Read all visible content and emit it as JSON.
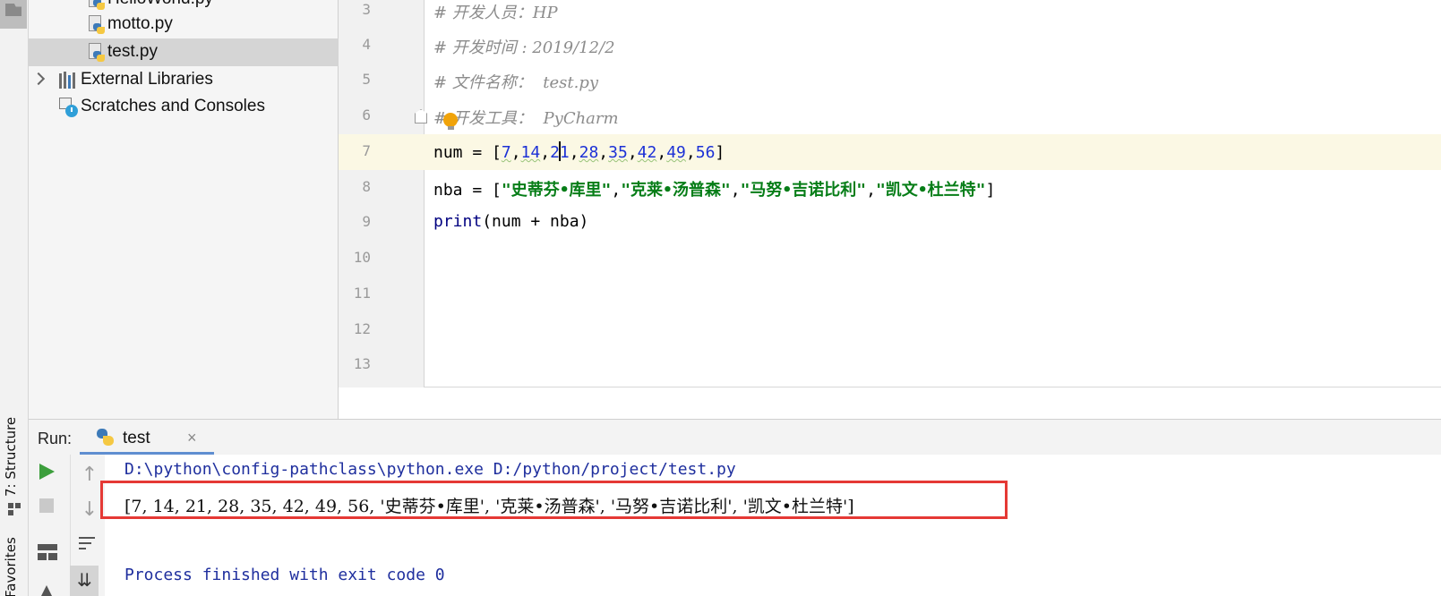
{
  "sidebar": {
    "structure_tab": "7: Structure",
    "favorites_tab": "Favorites"
  },
  "project_tree": {
    "items": [
      {
        "label": "HelloWorld.py",
        "type": "python-file"
      },
      {
        "label": "motto.py",
        "type": "python-file"
      },
      {
        "label": "test.py",
        "type": "python-file",
        "selected": true
      },
      {
        "label": "External Libraries",
        "type": "libraries"
      },
      {
        "label": "Scratches and Consoles",
        "type": "scratches"
      }
    ]
  },
  "editor": {
    "current_line": 7,
    "lines": [
      {
        "n": "3",
        "text": "# 开发人员：HP"
      },
      {
        "n": "4",
        "text": "# 开发时间 : 2019/12/2"
      },
      {
        "n": "5",
        "text": "# 文件名称：  test.py"
      },
      {
        "n": "6",
        "text": "开发工具：  PyCharm"
      },
      {
        "n": "7",
        "prefix": "num = [",
        "nums": [
          "7",
          "14",
          "2",
          "1",
          "28",
          "35",
          "42",
          "49",
          "56"
        ],
        "suffix": "]"
      },
      {
        "n": "8",
        "prefix": "nba = [",
        "strings": [
          "\"史蒂芬•库里\"",
          "\"克莱•汤普森\"",
          "\"马努•吉诺比利\"",
          "\"凯文•杜兰特\""
        ],
        "suffix": "]"
      },
      {
        "n": "9",
        "kw": "print",
        "rest": "(num + nba)"
      },
      {
        "n": "10",
        "text": ""
      },
      {
        "n": "11",
        "text": ""
      },
      {
        "n": "12",
        "text": ""
      },
      {
        "n": "13",
        "text": ""
      }
    ]
  },
  "run_panel": {
    "label": "Run:",
    "tab_label": "test",
    "tab_close": "×",
    "console": {
      "command": "D:\\python\\config-pathclass\\python.exe D:/python/project/test.py",
      "output": "[7, 14, 21, 28, 35, 42, 49, 56, '史蒂芬•库里', '克莱•汤普森', '马努•吉诺比利', '凯文•杜兰特']",
      "exit": "Process finished with exit code 0"
    },
    "highlight_color": "#e53935"
  },
  "colors": {
    "comment": "#8c8c8c",
    "number": "#1c31d6",
    "string": "#067d17",
    "keyword": "#000080",
    "console_path": "#1f2f9e",
    "current_line_bg": "#fbf8e4",
    "run_tab_underline": "#5f8ed0"
  },
  "icons": [
    "folder-icon",
    "python-file-icon",
    "chevron-right-icon",
    "libraries-icon",
    "scratches-icon",
    "lightbulb-icon",
    "fold-icon",
    "python-icon",
    "close-icon",
    "run-icon",
    "stop-icon",
    "up-arrow-icon",
    "down-arrow-icon",
    "layout-icon",
    "soft-wrap-icon",
    "scroll-to-end-icon",
    "pin-icon",
    "structure-icon"
  ]
}
